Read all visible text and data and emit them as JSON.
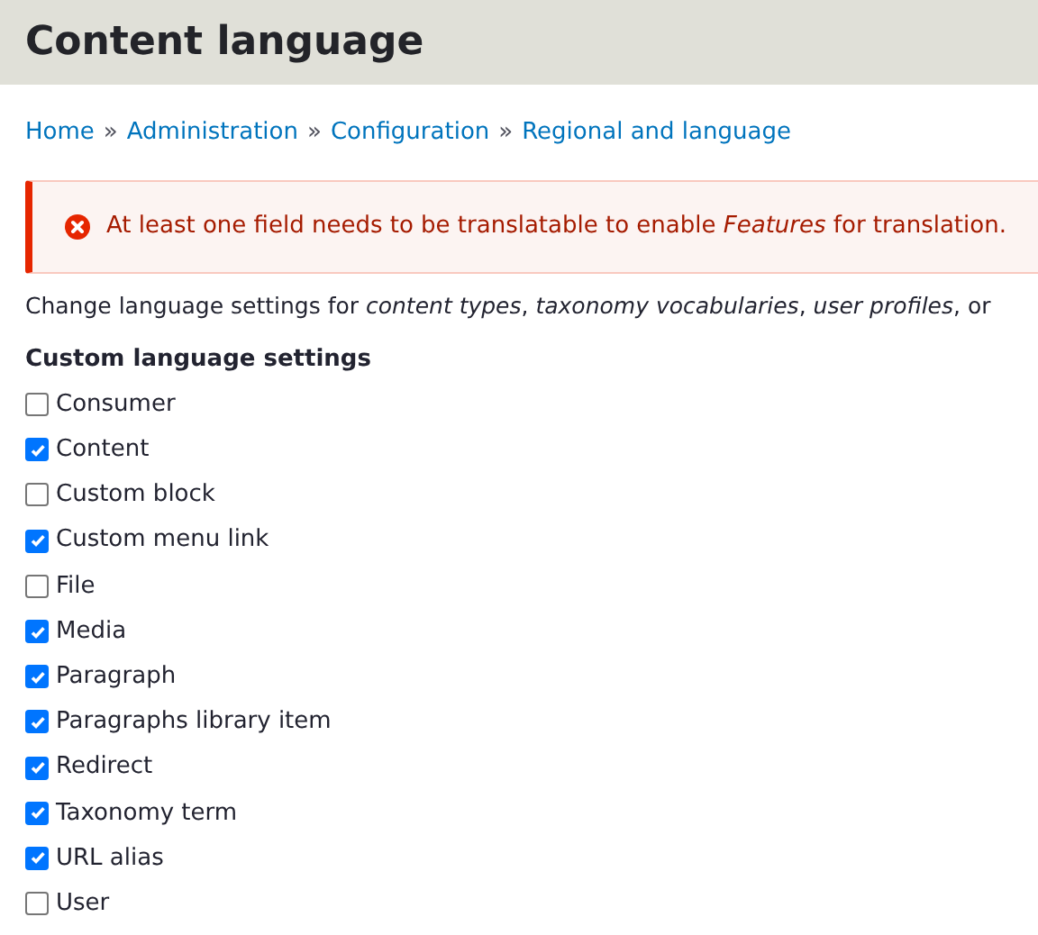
{
  "page_title": "Content language",
  "breadcrumb": [
    {
      "label": "Home"
    },
    {
      "label": "Administration"
    },
    {
      "label": "Configuration"
    },
    {
      "label": "Regional and language"
    }
  ],
  "breadcrumb_separator": "»",
  "error_message": "At least one field needs to be translatable to enable *Features* for translation.",
  "description": "Change language settings for *content types*, *taxonomy vocabularies*, *user profiles*, or",
  "settings": {
    "heading": "Custom language settings",
    "items": [
      {
        "label": "Consumer",
        "checked": false
      },
      {
        "label": "Content",
        "checked": true
      },
      {
        "label": "Custom block",
        "checked": false
      },
      {
        "label": "Custom menu link",
        "checked": true
      },
      {
        "label": "File",
        "checked": false
      },
      {
        "label": "Media",
        "checked": true
      },
      {
        "label": "Paragraph",
        "checked": true
      },
      {
        "label": "Paragraphs library item",
        "checked": true
      },
      {
        "label": "Redirect",
        "checked": true
      },
      {
        "label": "Taxonomy term",
        "checked": true
      },
      {
        "label": "URL alias",
        "checked": true
      },
      {
        "label": "User",
        "checked": false
      }
    ]
  }
}
